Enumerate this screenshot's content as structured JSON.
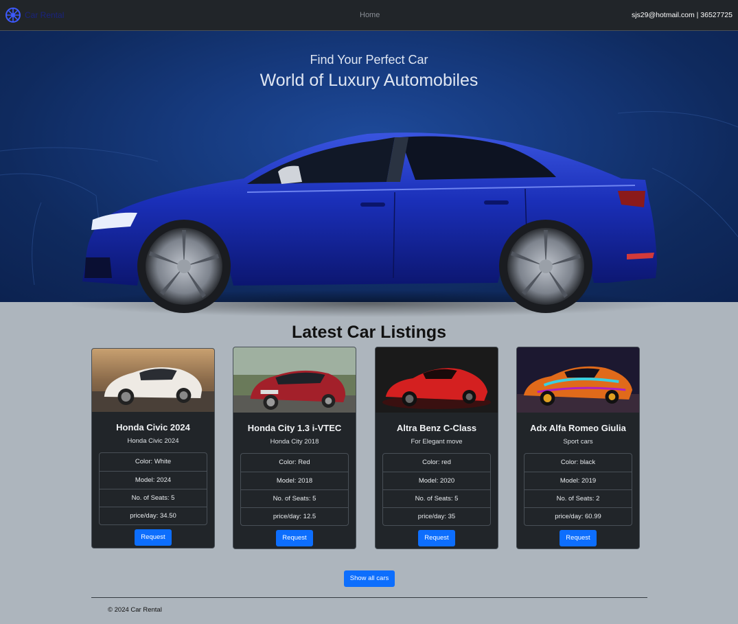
{
  "navbar": {
    "brand_text": "Car Rental",
    "home_label": "Home",
    "contact": "sjs29@hotmail.com | 36527725"
  },
  "hero": {
    "subtitle": "Find Your Perfect Car",
    "title": "World of Luxury Automobiles"
  },
  "listings": {
    "heading": "Latest Car Listings",
    "cards": [
      {
        "title": "Honda Civic 2024",
        "desc": "Honda Civic 2024",
        "color": "Color: White",
        "model": "Model: 2024",
        "seats": "No. of Seats: 5",
        "price": "price/day: 34.50",
        "button": "Request"
      },
      {
        "title": "Honda City 1.3 i-VTEC",
        "desc": "Honda City 2018",
        "color": "Color: Red",
        "model": "Model: 2018",
        "seats": "No. of Seats: 5",
        "price": "price/day: 12.5",
        "button": "Request"
      },
      {
        "title": "Altra Benz C-Class",
        "desc": "For Elegant move",
        "color": "Color: red",
        "model": "Model: 2020",
        "seats": "No. of Seats: 5",
        "price": "price/day: 35",
        "button": "Request"
      },
      {
        "title": "Adx Alfa Romeo Giulia",
        "desc": "Sport cars",
        "color": "Color: black",
        "model": "Model: 2019",
        "seats": "No. of Seats: 2",
        "price": "price/day: 60.99",
        "button": "Request"
      }
    ],
    "show_all_label": "Show all cars"
  },
  "footer": {
    "text": "© 2024 Car Rental"
  },
  "colors": {
    "navbar_bg": "#212529",
    "page_bg": "#adb5bd",
    "card_bg": "#212529",
    "accent": "#0d6efd",
    "hero_blue": "#163a7e"
  }
}
